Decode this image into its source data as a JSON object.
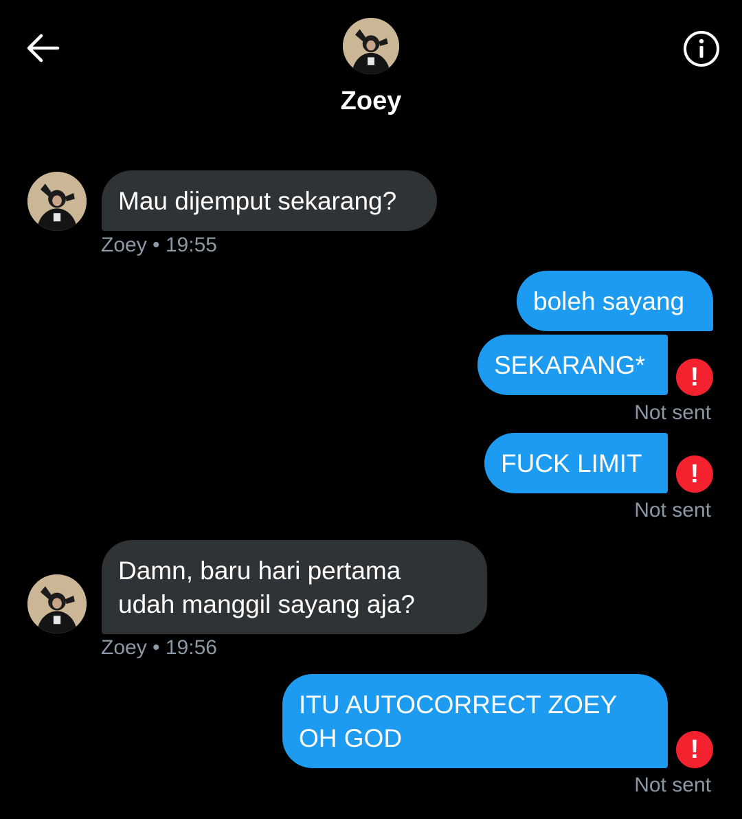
{
  "header": {
    "contact_name": "Zoey",
    "back_icon": "arrow-left-icon",
    "info_icon": "info-icon"
  },
  "messages": [
    {
      "direction": "incoming",
      "text": "Mau dijemput sekarang?",
      "meta": "Zoey • 19:55"
    },
    {
      "direction": "outgoing",
      "text": "boleh sayang",
      "meta": ""
    },
    {
      "direction": "outgoing",
      "text": "SEKARANG*",
      "status": "Not sent",
      "error_glyph": "!"
    },
    {
      "direction": "outgoing",
      "text": "FUCK LIMIT",
      "status": "Not sent",
      "error_glyph": "!"
    },
    {
      "direction": "incoming",
      "lines": [
        "Damn, baru hari pertama",
        "udah manggil sayang aja?"
      ],
      "meta": "Zoey • 19:56"
    },
    {
      "direction": "outgoing",
      "lines": [
        "ITU AUTOCORRECT ZOEY",
        "OH GOD"
      ],
      "status": "Not sent",
      "error_glyph": "!"
    }
  ],
  "colors": {
    "background": "#000000",
    "incoming_bubble": "#2f3336",
    "outgoing_bubble": "#1d9bf0",
    "error": "#f4212e",
    "meta_text": "#8b98a5"
  }
}
